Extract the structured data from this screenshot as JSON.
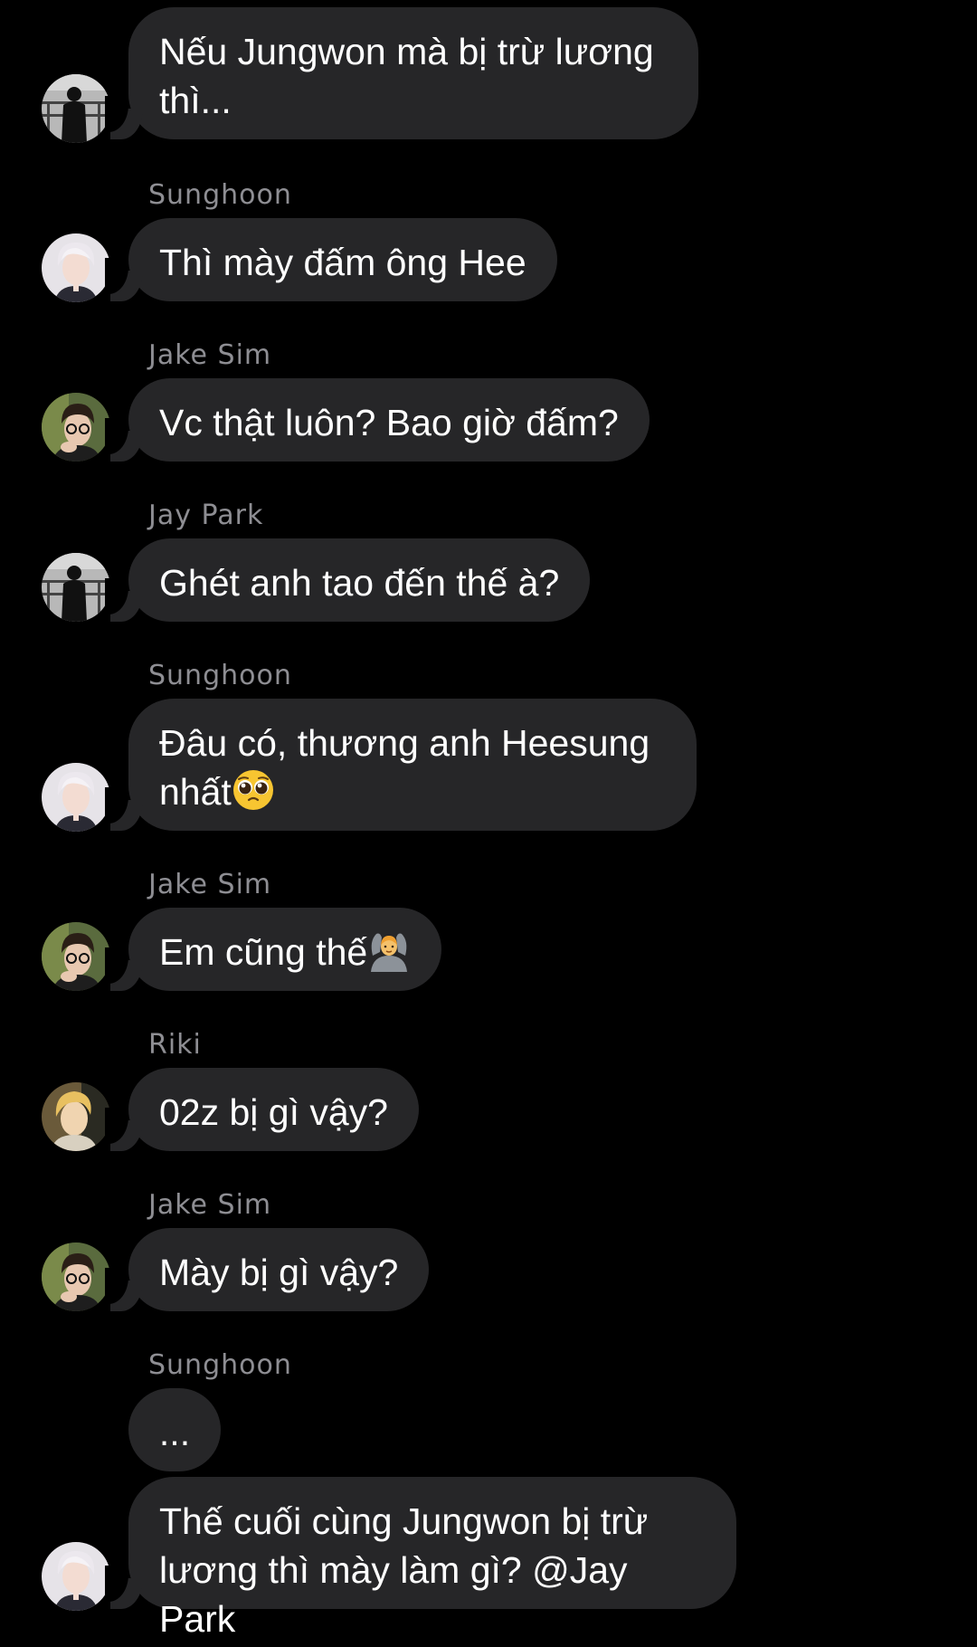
{
  "messages": [
    {
      "sender": "",
      "avatar": "jaypark-avatar",
      "text": "Nếu Jungwon mà bị trừ lương thì..."
    },
    {
      "sender": "Sunghoon",
      "avatar": "sunghoon-avatar",
      "text": "Thì mày đấm ông Hee"
    },
    {
      "sender": "Jake Sim",
      "avatar": "jakesim-avatar",
      "text": "Vc thật luôn? Bao giờ đấm?"
    },
    {
      "sender": "Jay Park",
      "avatar": "jaypark-avatar",
      "text": "Ghét anh tao đến thế à?"
    },
    {
      "sender": "Sunghoon",
      "avatar": "sunghoon-avatar",
      "text_line1": "Đâu có, thương anh Heesung",
      "text_line2": "nhất",
      "emoji": "pleading-face-icon"
    },
    {
      "sender": "Jake Sim",
      "avatar": "jakesim-avatar",
      "text": "Em cũng thế",
      "emoji": "person-gesturing-ok-icon"
    },
    {
      "sender": "Riki",
      "avatar": "riki-avatar",
      "text": "02z bị gì vậy?"
    },
    {
      "sender": "Jake Sim",
      "avatar": "jakesim-avatar",
      "text": "Mày bị gì vậy?"
    },
    {
      "sender": "Sunghoon",
      "avatar": "sunghoon-avatar",
      "text": "..."
    },
    {
      "sender": "",
      "avatar": "sunghoon-avatar",
      "text_line1": "Thế cuối cùng Jungwon bị trừ",
      "text_line2": "lương thì mày làm gì? @Jay Park"
    }
  ],
  "colors": {
    "background": "#000000",
    "bubble": "#262628",
    "sender_name": "#8e8e93",
    "text": "#ffffff"
  }
}
